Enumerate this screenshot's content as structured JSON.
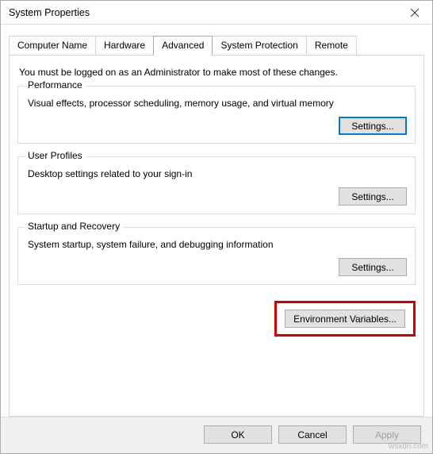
{
  "window": {
    "title": "System Properties"
  },
  "tabs": {
    "computer_name": "Computer Name",
    "hardware": "Hardware",
    "advanced": "Advanced",
    "system_protection": "System Protection",
    "remote": "Remote"
  },
  "advanced": {
    "admin_note": "You must be logged on as an Administrator to make most of these changes.",
    "performance": {
      "title": "Performance",
      "desc": "Visual effects, processor scheduling, memory usage, and virtual memory",
      "settings_label": "Settings..."
    },
    "user_profiles": {
      "title": "User Profiles",
      "desc": "Desktop settings related to your sign-in",
      "settings_label": "Settings..."
    },
    "startup_recovery": {
      "title": "Startup and Recovery",
      "desc": "System startup, system failure, and debugging information",
      "settings_label": "Settings..."
    },
    "env_vars_label": "Environment Variables..."
  },
  "dialog_buttons": {
    "ok": "OK",
    "cancel": "Cancel",
    "apply": "Apply"
  },
  "watermark": "wsxdn.com"
}
